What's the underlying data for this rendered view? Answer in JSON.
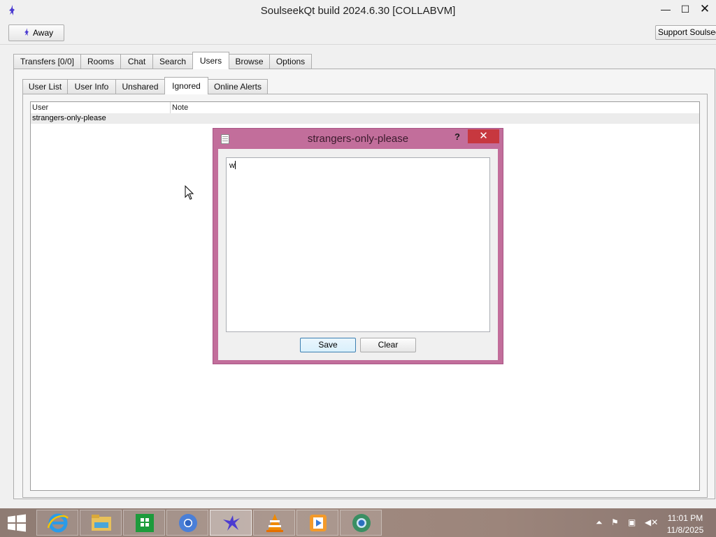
{
  "window": {
    "title": "SoulseekQt build 2024.6.30 [COLLABVM]"
  },
  "toolbar": {
    "away_label": "Away",
    "support_label": "Support Soulseek"
  },
  "main_tabs": [
    {
      "label": "Transfers [0/0]"
    },
    {
      "label": "Rooms"
    },
    {
      "label": "Chat"
    },
    {
      "label": "Search"
    },
    {
      "label": "Users",
      "active": true
    },
    {
      "label": "Browse"
    },
    {
      "label": "Options"
    }
  ],
  "sub_tabs": [
    {
      "label": "User List"
    },
    {
      "label": "User Info"
    },
    {
      "label": "Unshared"
    },
    {
      "label": "Ignored",
      "active": true
    },
    {
      "label": "Online Alerts"
    }
  ],
  "ignored_table": {
    "columns": [
      "User",
      "Note"
    ],
    "rows": [
      {
        "user": "strangers-only-please",
        "note": ""
      }
    ]
  },
  "dialog": {
    "title": "strangers-only-please",
    "help_glyph": "?",
    "close_glyph": "✕",
    "note_text": "w",
    "save_label": "Save",
    "clear_label": "Clear"
  },
  "taskbar": {
    "apps": [
      "internet-explorer",
      "file-explorer",
      "store",
      "chromium",
      "soulseek",
      "vlc",
      "media-player",
      "browser"
    ],
    "active_app": "soulseek",
    "clock_time": "11:01 PM",
    "clock_date": "11/8/2025"
  },
  "colors": {
    "dialog_frame": "#c26e9b",
    "close_button": "#c7383f",
    "taskbar": "#9c857b"
  }
}
